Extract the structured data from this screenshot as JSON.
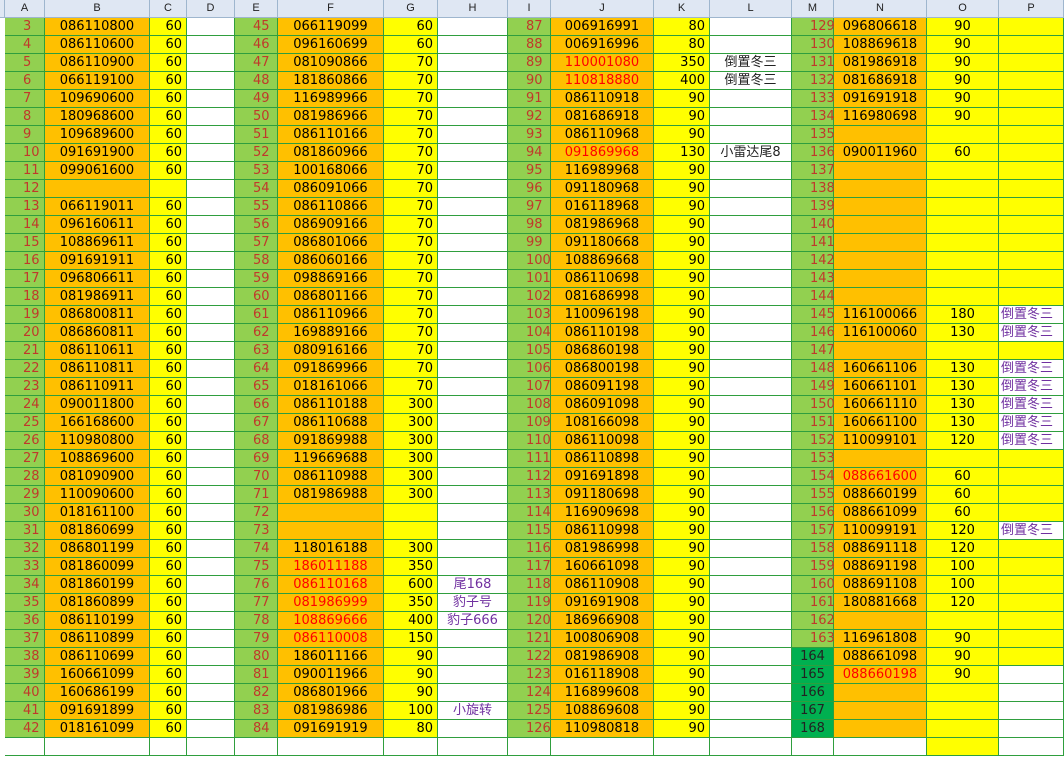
{
  "columns": [
    "A",
    "B",
    "C",
    "D",
    "E",
    "F",
    "G",
    "H",
    "I",
    "J",
    "K",
    "L",
    "M",
    "N",
    "O",
    "P"
  ],
  "colors": {
    "green": "#92d050",
    "orange": "#ffc000",
    "yellow": "#ffff00",
    "dark_green": "#00b050",
    "red_text": "#ff0000",
    "purple_text": "#7030a0"
  },
  "group1": {
    "rows": [
      {
        "i": "3",
        "num": "086110800",
        "p": "60"
      },
      {
        "i": "4",
        "num": "086110600",
        "p": "60"
      },
      {
        "i": "5",
        "num": "086110900",
        "p": "60"
      },
      {
        "i": "6",
        "num": "066119100",
        "p": "60"
      },
      {
        "i": "7",
        "num": "109690600",
        "p": "60"
      },
      {
        "i": "8",
        "num": "180968600",
        "p": "60"
      },
      {
        "i": "9",
        "num": "109689600",
        "p": "60"
      },
      {
        "i": "10",
        "num": "091691900",
        "p": "60"
      },
      {
        "i": "11",
        "num": "099061600",
        "p": "60"
      },
      {
        "i": "12",
        "num": "",
        "p": ""
      },
      {
        "i": "13",
        "num": "066119011",
        "p": "60"
      },
      {
        "i": "14",
        "num": "096160611",
        "p": "60"
      },
      {
        "i": "15",
        "num": "108869611",
        "p": "60"
      },
      {
        "i": "16",
        "num": "091691911",
        "p": "60"
      },
      {
        "i": "17",
        "num": "096806611",
        "p": "60"
      },
      {
        "i": "18",
        "num": "081986911",
        "p": "60"
      },
      {
        "i": "19",
        "num": "086800811",
        "p": "60"
      },
      {
        "i": "20",
        "num": "086860811",
        "p": "60"
      },
      {
        "i": "21",
        "num": "086110611",
        "p": "60"
      },
      {
        "i": "22",
        "num": "086110811",
        "p": "60"
      },
      {
        "i": "23",
        "num": "086110911",
        "p": "60"
      },
      {
        "i": "24",
        "num": "090011800",
        "p": "60"
      },
      {
        "i": "25",
        "num": "166168600",
        "p": "60"
      },
      {
        "i": "26",
        "num": "110980800",
        "p": "60"
      },
      {
        "i": "27",
        "num": "108869600",
        "p": "60"
      },
      {
        "i": "28",
        "num": "081090900",
        "p": "60"
      },
      {
        "i": "29",
        "num": "110090600",
        "p": "60"
      },
      {
        "i": "30",
        "num": "018161100",
        "p": "60"
      },
      {
        "i": "31",
        "num": "081860699",
        "p": "60"
      },
      {
        "i": "32",
        "num": "086801199",
        "p": "60"
      },
      {
        "i": "33",
        "num": "081860099",
        "p": "60"
      },
      {
        "i": "34",
        "num": "081860199",
        "p": "60"
      },
      {
        "i": "35",
        "num": "081860899",
        "p": "60"
      },
      {
        "i": "36",
        "num": "086110199",
        "p": "60"
      },
      {
        "i": "37",
        "num": "086110899",
        "p": "60"
      },
      {
        "i": "38",
        "num": "086110699",
        "p": "60"
      },
      {
        "i": "39",
        "num": "160661099",
        "p": "60"
      },
      {
        "i": "40",
        "num": "160686199",
        "p": "60"
      },
      {
        "i": "41",
        "num": "091691899",
        "p": "60"
      },
      {
        "i": "42",
        "num": "018161099",
        "p": "60"
      }
    ]
  },
  "group2": {
    "rows": [
      {
        "i": "45",
        "num": "066119099",
        "p": "60",
        "n": ""
      },
      {
        "i": "46",
        "num": "096160699",
        "p": "60",
        "n": ""
      },
      {
        "i": "47",
        "num": "081090866",
        "p": "70",
        "n": ""
      },
      {
        "i": "48",
        "num": "181860866",
        "p": "70",
        "n": ""
      },
      {
        "i": "49",
        "num": "116989966",
        "p": "70",
        "n": ""
      },
      {
        "i": "50",
        "num": "081986966",
        "p": "70",
        "n": ""
      },
      {
        "i": "51",
        "num": "086110166",
        "p": "70",
        "n": ""
      },
      {
        "i": "52",
        "num": "081860966",
        "p": "70",
        "n": ""
      },
      {
        "i": "53",
        "num": "100168066",
        "p": "70",
        "n": ""
      },
      {
        "i": "54",
        "num": "086091066",
        "p": "70",
        "n": ""
      },
      {
        "i": "55",
        "num": "086110866",
        "p": "70",
        "n": ""
      },
      {
        "i": "56",
        "num": "086909166",
        "p": "70",
        "n": ""
      },
      {
        "i": "57",
        "num": "086801066",
        "p": "70",
        "n": ""
      },
      {
        "i": "58",
        "num": "086060166",
        "p": "70",
        "n": ""
      },
      {
        "i": "59",
        "num": "098869166",
        "p": "70",
        "n": ""
      },
      {
        "i": "60",
        "num": "086801166",
        "p": "70",
        "n": ""
      },
      {
        "i": "61",
        "num": "086110966",
        "p": "70",
        "n": ""
      },
      {
        "i": "62",
        "num": "169889166",
        "p": "70",
        "n": ""
      },
      {
        "i": "63",
        "num": "080916166",
        "p": "70",
        "n": ""
      },
      {
        "i": "64",
        "num": "091869966",
        "p": "70",
        "n": ""
      },
      {
        "i": "65",
        "num": "018161066",
        "p": "70",
        "n": ""
      },
      {
        "i": "66",
        "num": "086110188",
        "p": "300",
        "n": ""
      },
      {
        "i": "67",
        "num": "086110688",
        "p": "300",
        "n": ""
      },
      {
        "i": "68",
        "num": "091869988",
        "p": "300",
        "n": ""
      },
      {
        "i": "69",
        "num": "119669688",
        "p": "300",
        "n": ""
      },
      {
        "i": "70",
        "num": "086110988",
        "p": "300",
        "n": ""
      },
      {
        "i": "71",
        "num": "081986988",
        "p": "300",
        "n": ""
      },
      {
        "i": "72",
        "num": "",
        "p": "",
        "n": ""
      },
      {
        "i": "73",
        "num": "",
        "p": "",
        "n": ""
      },
      {
        "i": "74",
        "num": "118016188",
        "p": "300",
        "n": ""
      },
      {
        "i": "75",
        "num": "186011188",
        "p": "350",
        "n": "",
        "red": true
      },
      {
        "i": "76",
        "num": "086110168",
        "p": "600",
        "n": "尾168",
        "red": true
      },
      {
        "i": "77",
        "num": "081986999",
        "p": "350",
        "n": "豹子号",
        "red": true
      },
      {
        "i": "78",
        "num": "108869666",
        "p": "400",
        "n": "豹子666",
        "red": true
      },
      {
        "i": "79",
        "num": "086110008",
        "p": "150",
        "n": "",
        "red": true
      },
      {
        "i": "80",
        "num": "186011166",
        "p": "90",
        "n": ""
      },
      {
        "i": "81",
        "num": "090011966",
        "p": "90",
        "n": ""
      },
      {
        "i": "82",
        "num": "086801966",
        "p": "90",
        "n": ""
      },
      {
        "i": "83",
        "num": "081986986",
        "p": "100",
        "n": "小旋转"
      },
      {
        "i": "84",
        "num": "091691919",
        "p": "80",
        "n": ""
      }
    ]
  },
  "group3": {
    "rows": [
      {
        "i": "87",
        "num": "006916991",
        "p": "80",
        "n": ""
      },
      {
        "i": "88",
        "num": "006916996",
        "p": "80",
        "n": ""
      },
      {
        "i": "89",
        "num": "110001080",
        "p": "350",
        "n": "倒置冬三",
        "red": true
      },
      {
        "i": "90",
        "num": "110818880",
        "p": "400",
        "n": "倒置冬三",
        "red": true
      },
      {
        "i": "91",
        "num": "086110918",
        "p": "90",
        "n": ""
      },
      {
        "i": "92",
        "num": "081686918",
        "p": "90",
        "n": ""
      },
      {
        "i": "93",
        "num": "086110968",
        "p": "90",
        "n": ""
      },
      {
        "i": "94",
        "num": "091869968",
        "p": "130",
        "n": "小雷达尾8",
        "red": true
      },
      {
        "i": "95",
        "num": "116989968",
        "p": "90",
        "n": ""
      },
      {
        "i": "96",
        "num": "091180968",
        "p": "90",
        "n": ""
      },
      {
        "i": "97",
        "num": "016118968",
        "p": "90",
        "n": ""
      },
      {
        "i": "98",
        "num": "081986968",
        "p": "90",
        "n": ""
      },
      {
        "i": "99",
        "num": "091180668",
        "p": "90",
        "n": ""
      },
      {
        "i": "100",
        "num": "108869668",
        "p": "90",
        "n": ""
      },
      {
        "i": "101",
        "num": "086110698",
        "p": "90",
        "n": ""
      },
      {
        "i": "102",
        "num": "081686998",
        "p": "90",
        "n": ""
      },
      {
        "i": "103",
        "num": "110096198",
        "p": "90",
        "n": ""
      },
      {
        "i": "104",
        "num": "086110198",
        "p": "90",
        "n": ""
      },
      {
        "i": "105",
        "num": "086860198",
        "p": "90",
        "n": ""
      },
      {
        "i": "106",
        "num": "086800198",
        "p": "90",
        "n": ""
      },
      {
        "i": "107",
        "num": "086091198",
        "p": "90",
        "n": ""
      },
      {
        "i": "108",
        "num": "086091098",
        "p": "90",
        "n": ""
      },
      {
        "i": "109",
        "num": "108166098",
        "p": "90",
        "n": ""
      },
      {
        "i": "110",
        "num": "086110098",
        "p": "90",
        "n": ""
      },
      {
        "i": "111",
        "num": "086110898",
        "p": "90",
        "n": ""
      },
      {
        "i": "112",
        "num": "091691898",
        "p": "90",
        "n": ""
      },
      {
        "i": "113",
        "num": "091180698",
        "p": "90",
        "n": ""
      },
      {
        "i": "114",
        "num": "116909698",
        "p": "90",
        "n": ""
      },
      {
        "i": "115",
        "num": "086110998",
        "p": "90",
        "n": ""
      },
      {
        "i": "116",
        "num": "081986998",
        "p": "90",
        "n": ""
      },
      {
        "i": "117",
        "num": "160661098",
        "p": "90",
        "n": ""
      },
      {
        "i": "118",
        "num": "086110908",
        "p": "90",
        "n": ""
      },
      {
        "i": "119",
        "num": "091691908",
        "p": "90",
        "n": ""
      },
      {
        "i": "120",
        "num": "186966908",
        "p": "90",
        "n": ""
      },
      {
        "i": "121",
        "num": "100806908",
        "p": "90",
        "n": ""
      },
      {
        "i": "122",
        "num": "081986908",
        "p": "90",
        "n": ""
      },
      {
        "i": "123",
        "num": "016118908",
        "p": "90",
        "n": ""
      },
      {
        "i": "124",
        "num": "116899608",
        "p": "90",
        "n": ""
      },
      {
        "i": "125",
        "num": "108869608",
        "p": "90",
        "n": ""
      },
      {
        "i": "126",
        "num": "110980818",
        "p": "90",
        "n": ""
      }
    ]
  },
  "group4": {
    "rows": [
      {
        "i": "129",
        "num": "096806618",
        "p": "90",
        "n": ""
      },
      {
        "i": "130",
        "num": "108869618",
        "p": "90",
        "n": ""
      },
      {
        "i": "131",
        "num": "081986918",
        "p": "90",
        "n": ""
      },
      {
        "i": "132",
        "num": "081686918",
        "p": "90",
        "n": ""
      },
      {
        "i": "133",
        "num": "091691918",
        "p": "90",
        "n": ""
      },
      {
        "i": "134",
        "num": "116980698",
        "p": "90",
        "n": ""
      },
      {
        "i": "135",
        "num": "",
        "p": "",
        "n": ""
      },
      {
        "i": "136",
        "num": "090011960",
        "p": "60",
        "n": ""
      },
      {
        "i": "137",
        "num": "",
        "p": "",
        "n": ""
      },
      {
        "i": "138",
        "num": "",
        "p": "",
        "n": ""
      },
      {
        "i": "139",
        "num": "",
        "p": "",
        "n": ""
      },
      {
        "i": "140",
        "num": "",
        "p": "",
        "n": ""
      },
      {
        "i": "141",
        "num": "",
        "p": "",
        "n": ""
      },
      {
        "i": "142",
        "num": "",
        "p": "",
        "n": ""
      },
      {
        "i": "143",
        "num": "",
        "p": "",
        "n": ""
      },
      {
        "i": "144",
        "num": "",
        "p": "",
        "n": ""
      },
      {
        "i": "145",
        "num": "116100066",
        "p": "180",
        "n": "倒置冬三"
      },
      {
        "i": "146",
        "num": "116100060",
        "p": "130",
        "n": "倒置冬三"
      },
      {
        "i": "147",
        "num": "",
        "p": "",
        "n": ""
      },
      {
        "i": "148",
        "num": "160661106",
        "p": "130",
        "n": "倒置冬三"
      },
      {
        "i": "149",
        "num": "160661101",
        "p": "130",
        "n": "倒置冬三"
      },
      {
        "i": "150",
        "num": "160661110",
        "p": "130",
        "n": "倒置冬三"
      },
      {
        "i": "151",
        "num": "160661100",
        "p": "130",
        "n": "倒置冬三"
      },
      {
        "i": "152",
        "num": "110099101",
        "p": "120",
        "n": "倒置冬三"
      },
      {
        "i": "153",
        "num": "",
        "p": "",
        "n": ""
      },
      {
        "i": "154",
        "num": "088661600",
        "p": "60",
        "n": "",
        "red": true
      },
      {
        "i": "155",
        "num": "088660199",
        "p": "60",
        "n": ""
      },
      {
        "i": "156",
        "num": "088661099",
        "p": "60",
        "n": ""
      },
      {
        "i": "157",
        "num": "110099191",
        "p": "120",
        "n": "倒置冬三"
      },
      {
        "i": "158",
        "num": "088691118",
        "p": "120",
        "n": ""
      },
      {
        "i": "159",
        "num": "088691198",
        "p": "100",
        "n": ""
      },
      {
        "i": "160",
        "num": "088691108",
        "p": "100",
        "n": ""
      },
      {
        "i": "161",
        "num": "180881668",
        "p": "120",
        "n": ""
      },
      {
        "i": "162",
        "num": "",
        "p": "",
        "n": ""
      },
      {
        "i": "163",
        "num": "116961808",
        "p": "90",
        "n": ""
      },
      {
        "i": "164",
        "num": "088661098",
        "p": "90",
        "n": ""
      },
      {
        "i": "165",
        "num": "088660198",
        "p": "90",
        "n": "",
        "red": true
      },
      {
        "i": "166",
        "num": "",
        "p": "",
        "n": ""
      },
      {
        "i": "167",
        "num": "",
        "p": "",
        "n": ""
      },
      {
        "i": "168",
        "num": "",
        "p": "",
        "n": ""
      }
    ]
  }
}
